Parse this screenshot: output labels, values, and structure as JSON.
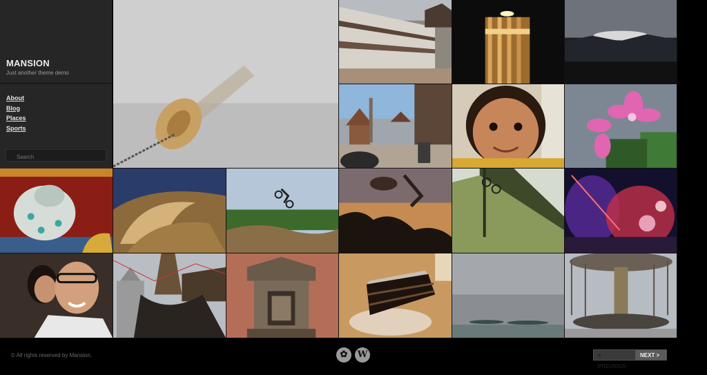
{
  "site": {
    "title": "MANSION",
    "tagline": "Just another theme demo"
  },
  "nav": {
    "items": [
      {
        "label": "About"
      },
      {
        "label": "Blog"
      },
      {
        "label": "Places"
      },
      {
        "label": "Sports"
      }
    ]
  },
  "search": {
    "placeholder": "Search"
  },
  "photos": [
    {
      "name": "fog-buoy-photo"
    },
    {
      "name": "nepal-palace-photo"
    },
    {
      "name": "lantern-photo"
    },
    {
      "name": "mountain-sunset-photo"
    },
    {
      "name": "durbar-square-photo"
    },
    {
      "name": "smiling-child-photo"
    },
    {
      "name": "pink-flower-photo"
    },
    {
      "name": "dragon-statue-photo"
    },
    {
      "name": "stupa-dome-photo"
    },
    {
      "name": "bmx-jump-photo"
    },
    {
      "name": "skater-silhouette-photo"
    },
    {
      "name": "bike-ramp-photo"
    },
    {
      "name": "concert-lights-photo"
    },
    {
      "name": "couple-selfie-photo"
    },
    {
      "name": "temple-prayer-flags-photo"
    },
    {
      "name": "stone-shrine-photo"
    },
    {
      "name": "chocolate-cake-photo"
    },
    {
      "name": "cloudy-sea-photo"
    },
    {
      "name": "carousel-photo"
    }
  ],
  "footer": {
    "copyright": "© All rights reserved by Mansion.",
    "icons": [
      "theme-logo-icon",
      "wordpress-icon"
    ],
    "previous_label": "< PREVIOUS",
    "next_label": "NEXT >"
  }
}
